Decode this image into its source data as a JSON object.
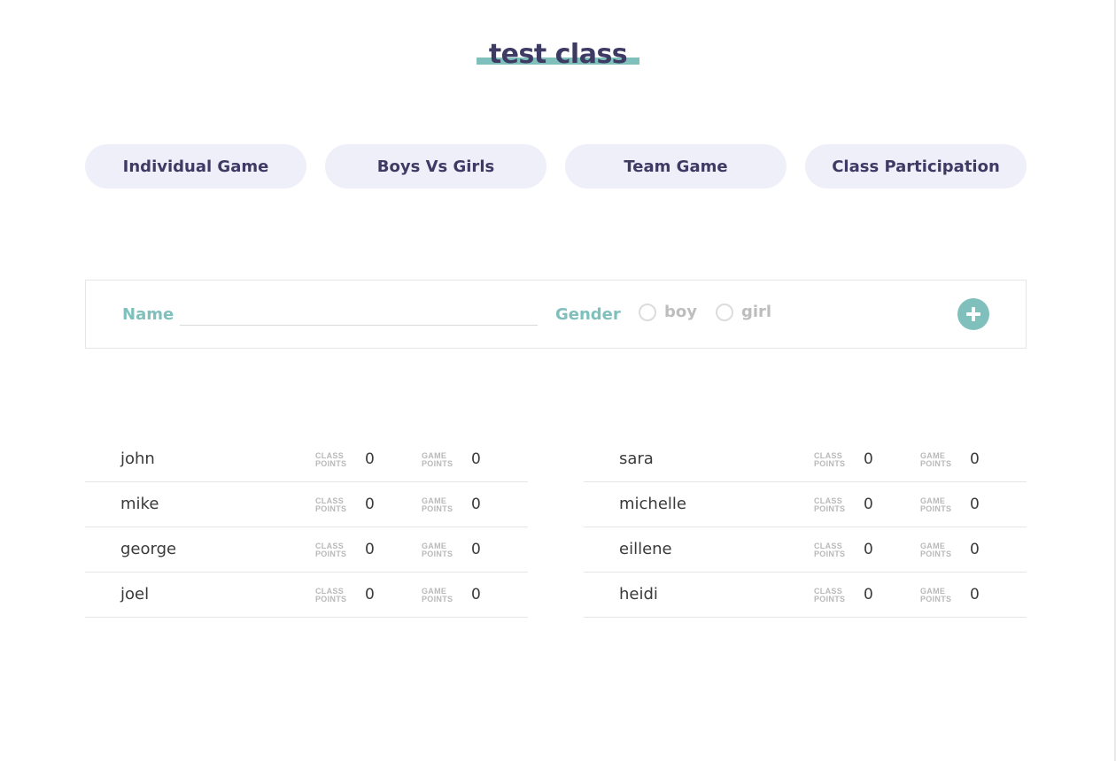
{
  "title": "test class",
  "modes": [
    {
      "label": "Individual Game"
    },
    {
      "label": "Boys Vs Girls"
    },
    {
      "label": "Team Game"
    },
    {
      "label": "Class Participation"
    }
  ],
  "form": {
    "name_label": "Name",
    "name_value": "",
    "gender_label": "Gender",
    "option_boy": "boy",
    "option_girl": "girl",
    "add_icon": "plus-icon"
  },
  "point_labels": {
    "class_line1": "CLASS",
    "class_line2": "POINTS",
    "game_line1": "GAME",
    "game_line2": "POINTS"
  },
  "boys": [
    {
      "name": "john",
      "class_points": "0",
      "game_points": "0"
    },
    {
      "name": "mike",
      "class_points": "0",
      "game_points": "0"
    },
    {
      "name": "george",
      "class_points": "0",
      "game_points": "0"
    },
    {
      "name": "joel",
      "class_points": "0",
      "game_points": "0"
    }
  ],
  "girls": [
    {
      "name": "sara",
      "class_points": "0",
      "game_points": "0"
    },
    {
      "name": "michelle",
      "class_points": "0",
      "game_points": "0"
    },
    {
      "name": "eillene",
      "class_points": "0",
      "game_points": "0"
    },
    {
      "name": "heidi",
      "class_points": "0",
      "game_points": "0"
    }
  ],
  "colors": {
    "accent": "#7fc0bd",
    "text_dark": "#3d3a63",
    "button_bg": "#efeff9"
  }
}
